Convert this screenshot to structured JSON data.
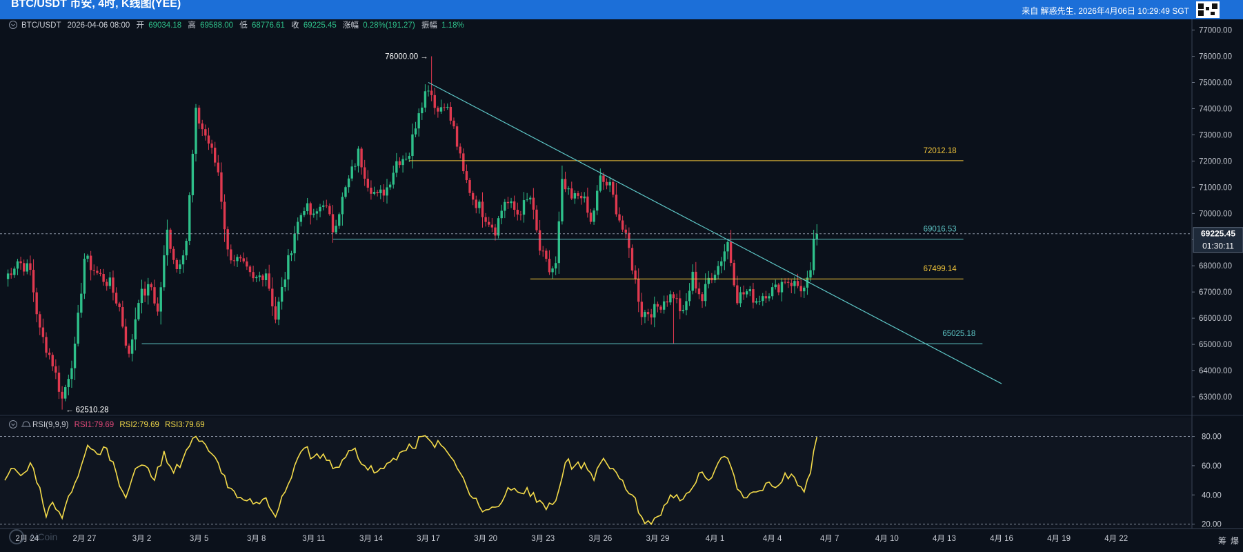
{
  "header": {
    "title": "BTC/USDT 币安, 4时, K线图(YEE)",
    "right_text": "来自 解惑先生, 2026年4月06日 10:29:49 SGT"
  },
  "info_bar": {
    "symbol": "BTC/USDT",
    "datetime": "2026-04-06 08:00",
    "open_label": "开",
    "open": "69034.18",
    "high_label": "高",
    "high": "69588.00",
    "low_label": "低",
    "low": "68776.61",
    "close_label": "收",
    "close": "69225.45",
    "change_label": "涨幅",
    "change": "0.28%(191.27)",
    "amp_label": "振幅",
    "amp": "1.18%"
  },
  "rsi_bar": {
    "name": "RSI(9,9,9)",
    "rsi1": "RSI1:79.69",
    "rsi2": "RSI2:79.69",
    "rsi3": "RSI3:79.69"
  },
  "price_tag": {
    "price": "69225.45",
    "countdown": "01:30:11"
  },
  "extreme_labels": {
    "high": "76000.00",
    "low": "62510.28"
  },
  "footer": {
    "right_chars": [
      "筹",
      "爆"
    ],
    "logo_text": "AiCoin"
  },
  "colors": {
    "up": "#2ec08a",
    "down": "#e0394f",
    "rsi": "#f5dc4a",
    "hline_yellow": "#f0c43a",
    "hline_cyan": "#5ec7c7",
    "trend": "#5ec7c7",
    "header": "#1c6fd8",
    "background": "#0b111b"
  },
  "chart_data": {
    "type": "candlestick",
    "title": "BTC/USDT",
    "interval": "4h",
    "y_axis": {
      "ticks": [
        "77000.00",
        "76000.00",
        "75000.00",
        "74000.00",
        "73000.00",
        "72000.00",
        "71000.00",
        "70000.00",
        "69000.00",
        "68000.00",
        "67000.00",
        "66000.00",
        "65000.00",
        "64000.00",
        "63000.00"
      ],
      "range": [
        62500,
        77200
      ],
      "position": "right"
    },
    "x_axis": {
      "ticks": [
        {
          "label": "2月 24",
          "date": "2026-02-24"
        },
        {
          "label": "2月 27",
          "date": "2026-02-27"
        },
        {
          "label": "3月 2",
          "date": "2026-03-02"
        },
        {
          "label": "3月 5",
          "date": "2026-03-05"
        },
        {
          "label": "3月 8",
          "date": "2026-03-08"
        },
        {
          "label": "3月 11",
          "date": "2026-03-11"
        },
        {
          "label": "3月 14",
          "date": "2026-03-14"
        },
        {
          "label": "3月 17",
          "date": "2026-03-17"
        },
        {
          "label": "3月 20",
          "date": "2026-03-20"
        },
        {
          "label": "3月 23",
          "date": "2026-03-23"
        },
        {
          "label": "3月 26",
          "date": "2026-03-26"
        },
        {
          "label": "3月 29",
          "date": "2026-03-29"
        },
        {
          "label": "4月 1",
          "date": "2026-04-01"
        },
        {
          "label": "4月 4",
          "date": "2026-04-04"
        },
        {
          "label": "4月 7",
          "date": "2026-04-07"
        },
        {
          "label": "4月 10",
          "date": "2026-04-10"
        },
        {
          "label": "4月 13",
          "date": "2026-04-13"
        },
        {
          "label": "4月 16",
          "date": "2026-04-16"
        },
        {
          "label": "4月 19",
          "date": "2026-04-19"
        },
        {
          "label": "4月 22",
          "date": "2026-04-22"
        }
      ]
    },
    "price_keypoints": [
      [
        "2026-02-22T20:00",
        67500
      ],
      [
        "2026-02-23T12:00",
        68200
      ],
      [
        "2026-02-24T04:00",
        67800
      ],
      [
        "2026-02-24T16:00",
        65500
      ],
      [
        "2026-02-25T08:00",
        64300
      ],
      [
        "2026-02-25T20:00",
        62900
      ],
      [
        "2026-02-26T12:00",
        64800
      ],
      [
        "2026-02-27T00:00",
        68300
      ],
      [
        "2026-02-27T16:00",
        67700
      ],
      [
        "2026-02-28T08:00",
        67300
      ],
      [
        "2026-02-28T20:00",
        66400
      ],
      [
        "2026-03-01T08:00",
        64500
      ],
      [
        "2026-03-01T20:00",
        66800
      ],
      [
        "2026-03-02T12:00",
        67200
      ],
      [
        "2026-03-02T20:00",
        66200
      ],
      [
        "2026-03-03T08:00",
        69300
      ],
      [
        "2026-03-03T20:00",
        67900
      ],
      [
        "2026-03-04T08:00",
        69000
      ],
      [
        "2026-03-04T20:00",
        73800
      ],
      [
        "2026-03-05T12:00",
        72700
      ],
      [
        "2026-03-06T00:00",
        71600
      ],
      [
        "2026-03-06T12:00",
        68500
      ],
      [
        "2026-03-07T04:00",
        68100
      ],
      [
        "2026-03-07T20:00",
        67400
      ],
      [
        "2026-03-08T12:00",
        67800
      ],
      [
        "2026-03-09T00:00",
        66000
      ],
      [
        "2026-03-09T12:00",
        67600
      ],
      [
        "2026-03-10T00:00",
        69300
      ],
      [
        "2026-03-10T12:00",
        70300
      ],
      [
        "2026-03-11T00:00",
        69800
      ],
      [
        "2026-03-11T12:00",
        70500
      ],
      [
        "2026-03-12T00:00",
        69400
      ],
      [
        "2026-03-12T16:00",
        70900
      ],
      [
        "2026-03-13T08:00",
        72300
      ],
      [
        "2026-03-13T20:00",
        71200
      ],
      [
        "2026-03-14T08:00",
        70600
      ],
      [
        "2026-03-14T20:00",
        71000
      ],
      [
        "2026-03-15T08:00",
        72000
      ],
      [
        "2026-03-16T00:00",
        72300
      ],
      [
        "2026-03-16T12:00",
        74000
      ],
      [
        "2026-03-17T00:00",
        74900
      ],
      [
        "2026-03-17T12:00",
        73900
      ],
      [
        "2026-03-17T20:00",
        74300
      ],
      [
        "2026-03-18T08:00",
        73200
      ],
      [
        "2026-03-18T20:00",
        71500
      ],
      [
        "2026-03-19T08:00",
        70600
      ],
      [
        "2026-03-20T00:00",
        69900
      ],
      [
        "2026-03-20T12:00",
        69400
      ],
      [
        "2026-03-21T00:00",
        70500
      ],
      [
        "2026-03-21T16:00",
        70000
      ],
      [
        "2026-03-22T08:00",
        70600
      ],
      [
        "2026-03-22T20:00",
        68600
      ],
      [
        "2026-03-23T08:00",
        67800
      ],
      [
        "2026-03-23T16:00",
        68000
      ],
      [
        "2026-03-24T00:00",
        71100
      ],
      [
        "2026-03-24T12:00",
        70500
      ],
      [
        "2026-03-25T00:00",
        70800
      ],
      [
        "2026-03-25T12:00",
        69600
      ],
      [
        "2026-03-26T00:00",
        71300
      ],
      [
        "2026-03-26T12:00",
        71000
      ],
      [
        "2026-03-27T00:00",
        69800
      ],
      [
        "2026-03-27T12:00",
        68600
      ],
      [
        "2026-03-28T04:00",
        66200
      ],
      [
        "2026-03-28T20:00",
        66300
      ],
      [
        "2026-03-29T08:00",
        66700
      ],
      [
        "2026-03-29T20:00",
        66900
      ],
      [
        "2026-03-30T08:00",
        66100
      ],
      [
        "2026-03-30T20:00",
        67600
      ],
      [
        "2026-03-31T08:00",
        66700
      ],
      [
        "2026-03-31T16:00",
        67500
      ],
      [
        "2026-04-01T04:00",
        68000
      ],
      [
        "2026-04-01T16:00",
        68900
      ],
      [
        "2026-04-02T04:00",
        66800
      ],
      [
        "2026-04-02T16:00",
        67000
      ],
      [
        "2026-04-03T04:00",
        66700
      ],
      [
        "2026-04-03T16:00",
        67000
      ],
      [
        "2026-04-04T04:00",
        67100
      ],
      [
        "2026-04-04T16:00",
        67500
      ],
      [
        "2026-04-05T04:00",
        67300
      ],
      [
        "2026-04-05T16:00",
        67100
      ],
      [
        "2026-04-06T00:00",
        67600
      ],
      [
        "2026-04-06T04:00",
        69034
      ],
      [
        "2026-04-06T08:00",
        69225
      ]
    ],
    "lows": [
      [
        "2026-02-25T20:00",
        62510.28
      ],
      [
        "2026-03-29T20:00",
        65025.18
      ]
    ],
    "highs": [
      [
        "2026-03-17T04:00",
        76000.0
      ]
    ],
    "horizontal_lines": [
      {
        "value": 72012.18,
        "label": "72012.18",
        "color": "#f0c43a",
        "from": "2026-03-16T00:00",
        "to": "2026-04-14T00:00"
      },
      {
        "value": 69016.53,
        "label": "69016.53",
        "color": "#5ec7c7",
        "from": "2026-03-12T00:00",
        "to": "2026-04-14T00:00"
      },
      {
        "value": 67499.14,
        "label": "67499.14",
        "color": "#f0c43a",
        "from": "2026-03-22T08:00",
        "to": "2026-04-14T00:00"
      },
      {
        "value": 65025.18,
        "label": "65025.18",
        "color": "#5ec7c7",
        "from": "2026-03-02T00:00",
        "to": "2026-04-15T00:00"
      }
    ],
    "trend_line": {
      "from": [
        "2026-03-17T00:00",
        75000
      ],
      "to": [
        "2026-04-16T00:00",
        63500
      ]
    },
    "rsi": {
      "name": "RSI(9,9,9)",
      "y_axis": {
        "ticks": [
          "80.00",
          "60.00",
          "40.00",
          "20.00"
        ],
        "range": [
          17,
          93
        ]
      },
      "reference_lines": [
        80,
        20
      ],
      "keypoints": [
        [
          "2026-02-22T20:00",
          50
        ],
        [
          "2026-02-23T08:00",
          58
        ],
        [
          "2026-02-23T20:00",
          55
        ],
        [
          "2026-02-24T04:00",
          62
        ],
        [
          "2026-02-24T16:00",
          45
        ],
        [
          "2026-02-25T00:00",
          25
        ],
        [
          "2026-02-25T08:00",
          35
        ],
        [
          "2026-02-25T20:00",
          24
        ],
        [
          "2026-02-26T08:00",
          42
        ],
        [
          "2026-02-26T20:00",
          60
        ],
        [
          "2026-02-27T04:00",
          74
        ],
        [
          "2026-02-27T16:00",
          68
        ],
        [
          "2026-02-28T04:00",
          72
        ],
        [
          "2026-02-28T16:00",
          55
        ],
        [
          "2026-03-01T04:00",
          38
        ],
        [
          "2026-03-01T16:00",
          58
        ],
        [
          "2026-03-02T04:00",
          60
        ],
        [
          "2026-03-02T16:00",
          50
        ],
        [
          "2026-03-03T04:00",
          70
        ],
        [
          "2026-03-03T16:00",
          55
        ],
        [
          "2026-03-04T04:00",
          65
        ],
        [
          "2026-03-04T20:00",
          80
        ],
        [
          "2026-03-05T12:00",
          70
        ],
        [
          "2026-03-06T00:00",
          62
        ],
        [
          "2026-03-06T12:00",
          45
        ],
        [
          "2026-03-07T00:00",
          38
        ],
        [
          "2026-03-07T12:00",
          36
        ],
        [
          "2026-03-08T00:00",
          35
        ],
        [
          "2026-03-08T12:00",
          38
        ],
        [
          "2026-03-09T00:00",
          25
        ],
        [
          "2026-03-09T12:00",
          42
        ],
        [
          "2026-03-10T00:00",
          60
        ],
        [
          "2026-03-10T12:00",
          72
        ],
        [
          "2026-03-11T00:00",
          66
        ],
        [
          "2026-03-11T12:00",
          68
        ],
        [
          "2026-03-12T00:00",
          58
        ],
        [
          "2026-03-12T12:00",
          64
        ],
        [
          "2026-03-13T04:00",
          72
        ],
        [
          "2026-03-13T16:00",
          60
        ],
        [
          "2026-03-14T04:00",
          55
        ],
        [
          "2026-03-14T16:00",
          58
        ],
        [
          "2026-03-15T04:00",
          65
        ],
        [
          "2026-03-15T16:00",
          70
        ],
        [
          "2026-03-16T04:00",
          72
        ],
        [
          "2026-03-16T16:00",
          80
        ],
        [
          "2026-03-17T04:00",
          76
        ],
        [
          "2026-03-17T16:00",
          74
        ],
        [
          "2026-03-18T04:00",
          66
        ],
        [
          "2026-03-18T16:00",
          55
        ],
        [
          "2026-03-19T04:00",
          40
        ],
        [
          "2026-03-19T16:00",
          32
        ],
        [
          "2026-03-20T04:00",
          30
        ],
        [
          "2026-03-20T16:00",
          32
        ],
        [
          "2026-03-21T04:00",
          45
        ],
        [
          "2026-03-21T16:00",
          42
        ],
        [
          "2026-03-22T04:00",
          45
        ],
        [
          "2026-03-22T16:00",
          35
        ],
        [
          "2026-03-23T04:00",
          30
        ],
        [
          "2026-03-23T16:00",
          36
        ],
        [
          "2026-03-24T04:00",
          62
        ],
        [
          "2026-03-24T16:00",
          60
        ],
        [
          "2026-03-25T04:00",
          62
        ],
        [
          "2026-03-25T16:00",
          50
        ],
        [
          "2026-03-26T04:00",
          65
        ],
        [
          "2026-03-26T16:00",
          58
        ],
        [
          "2026-03-27T04:00",
          50
        ],
        [
          "2026-03-27T16:00",
          40
        ],
        [
          "2026-03-28T04:00",
          25
        ],
        [
          "2026-03-28T16:00",
          20
        ],
        [
          "2026-03-29T04:00",
          26
        ],
        [
          "2026-03-29T16:00",
          40
        ],
        [
          "2026-03-30T04:00",
          36
        ],
        [
          "2026-03-30T16:00",
          42
        ],
        [
          "2026-03-31T04:00",
          55
        ],
        [
          "2026-03-31T16:00",
          50
        ],
        [
          "2026-04-01T04:00",
          62
        ],
        [
          "2026-04-01T16:00",
          65
        ],
        [
          "2026-04-02T04:00",
          44
        ],
        [
          "2026-04-02T16:00",
          38
        ],
        [
          "2026-04-03T04:00",
          42
        ],
        [
          "2026-04-03T16:00",
          48
        ],
        [
          "2026-04-04T04:00",
          45
        ],
        [
          "2026-04-04T16:00",
          55
        ],
        [
          "2026-04-05T04:00",
          52
        ],
        [
          "2026-04-05T16:00",
          42
        ],
        [
          "2026-04-06T00:00",
          55
        ],
        [
          "2026-04-06T04:00",
          70
        ],
        [
          "2026-04-06T08:00",
          79.69
        ]
      ]
    }
  }
}
